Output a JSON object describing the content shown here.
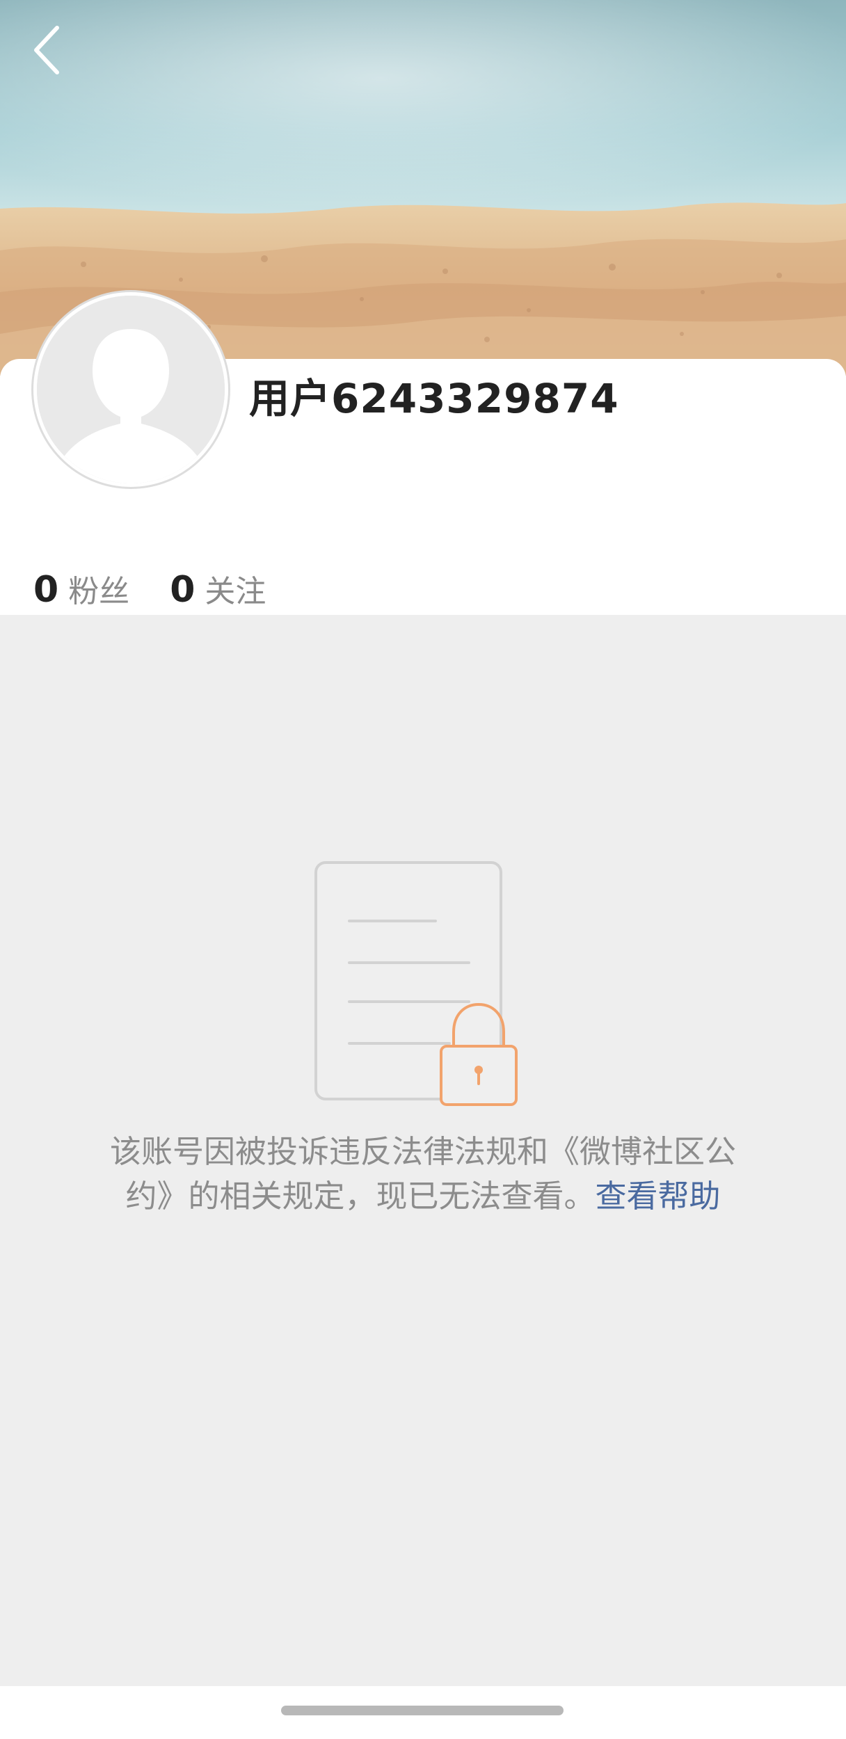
{
  "profile": {
    "username": "用户6243329874",
    "followers_count": "0",
    "followers_label": "粉丝",
    "following_count": "0",
    "following_label": "关注"
  },
  "blocked_notice": {
    "message": "该账号因被投诉违反法律法规和《微博社区公约》的相关规定，现已无法查看。",
    "help_link": "查看帮助"
  },
  "icons": {
    "back": "chevron-left-icon",
    "avatar": "default-avatar-silhouette",
    "illustration": "locked-document-icon"
  },
  "colors": {
    "link": "#4a6aa0",
    "lock_accent": "#f2a36c",
    "background": "#eeeeee"
  }
}
